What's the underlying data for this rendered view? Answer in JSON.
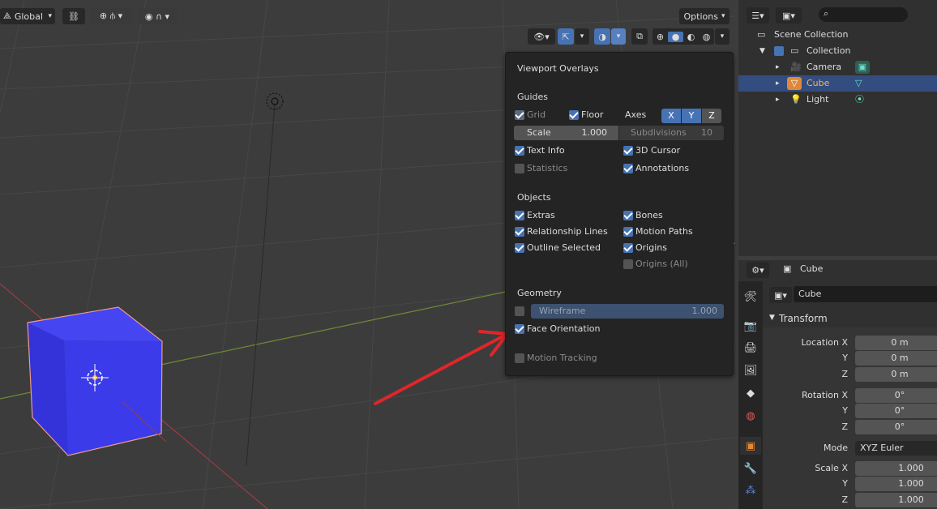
{
  "viewport_header": {
    "orientation_label": "Global",
    "options_label": "Options"
  },
  "overlays": {
    "title": "Viewport Overlays",
    "guides": {
      "heading": "Guides",
      "grid": {
        "label": "Grid",
        "checked": true,
        "enabled": false
      },
      "floor": {
        "label": "Floor",
        "checked": true
      },
      "axes_label": "Axes",
      "axes": [
        "X",
        "Y",
        "Z"
      ],
      "scale_label": "Scale",
      "scale_value": "1.000",
      "subdivisions_label": "Subdivisions",
      "subdivisions_value": "10",
      "text_info": {
        "label": "Text Info",
        "checked": true
      },
      "cursor_3d": {
        "label": "3D Cursor",
        "checked": true
      },
      "statistics": {
        "label": "Statistics",
        "checked": false
      },
      "annotations": {
        "label": "Annotations",
        "checked": true
      }
    },
    "objects": {
      "heading": "Objects",
      "extras": {
        "label": "Extras",
        "checked": true
      },
      "bones": {
        "label": "Bones",
        "checked": true
      },
      "relationship_lines": {
        "label": "Relationship Lines",
        "checked": true
      },
      "motion_paths": {
        "label": "Motion Paths",
        "checked": true
      },
      "outline_selected": {
        "label": "Outline Selected",
        "checked": true
      },
      "origins": {
        "label": "Origins",
        "checked": true
      },
      "origins_all": {
        "label": "Origins (All)",
        "checked": false
      }
    },
    "geometry": {
      "heading": "Geometry",
      "wireframe_label": "Wireframe",
      "wireframe_value": "1.000",
      "face_orientation": {
        "label": "Face Orientation",
        "checked": true
      }
    },
    "motion_tracking": {
      "label": "Motion Tracking",
      "checked": false
    }
  },
  "outliner": {
    "search_placeholder": "",
    "scene_collection": "Scene Collection",
    "collection": "Collection",
    "items": [
      {
        "name": "Camera",
        "selected": false
      },
      {
        "name": "Cube",
        "selected": true
      },
      {
        "name": "Light",
        "selected": false
      }
    ]
  },
  "properties": {
    "header_object": "Cube",
    "object_name": "Cube",
    "transform_heading": "Transform",
    "location": {
      "x_label": "Location X",
      "y_label": "Y",
      "z_label": "Z",
      "x": "0 m",
      "y": "0 m",
      "z": "0 m"
    },
    "rotation": {
      "x_label": "Rotation X",
      "y_label": "Y",
      "z_label": "Z",
      "x": "0°",
      "y": "0°",
      "z": "0°"
    },
    "mode_label": "Mode",
    "mode_value": "XYZ Euler",
    "scale": {
      "x_label": "Scale X",
      "y_label": "Y",
      "z_label": "Z",
      "x": "1.000",
      "y": "1.000",
      "z": "1.000"
    }
  },
  "colors": {
    "accent": "#4772b3",
    "selected_row": "#334d80",
    "cube_face": "#3a3ae8",
    "cube_outline": "#f09a8a",
    "annotation_arrow": "#e0262a"
  }
}
